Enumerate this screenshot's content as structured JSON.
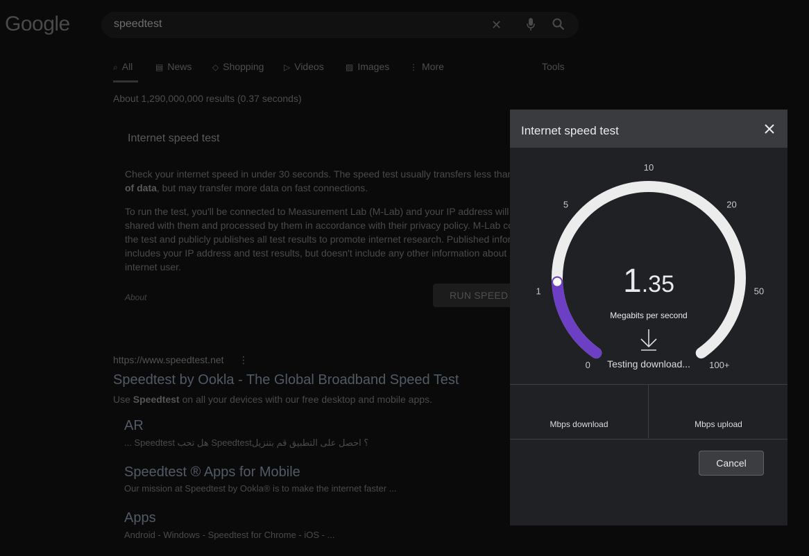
{
  "google": {
    "logo": "Google",
    "search_value": "speedtest",
    "tabs": [
      {
        "label": "All",
        "glyph": "⌕"
      },
      {
        "label": "News",
        "glyph": "▤"
      },
      {
        "label": "Shopping",
        "glyph": "◇"
      },
      {
        "label": "Videos",
        "glyph": "▷"
      },
      {
        "label": "Images",
        "glyph": "▨"
      },
      {
        "label": "More",
        "glyph": "⋮"
      }
    ],
    "tools": "Tools",
    "results_count": "About 1,290,000,000 results (0.37 seconds)",
    "card_title": "Internet speed test",
    "para1_a": "Check your internet speed in under 30 seconds. The speed test usually transfers less than",
    "para1_bold": "of data",
    "para1_b": ", but may transfer more data on fast connections.",
    "para2_lines": [
      "To run the test, you'll be connected to Measurement Lab (M-Lab) and your IP address will",
      "shared with them and processed by them in accordance with their privacy policy. M-Lab co",
      "the test and publicly publishes all test results to promote internet research. Published infor",
      "includes your IP address and test results, but doesn't include any other information about",
      "internet user."
    ],
    "about": "About",
    "run_button": "RUN SPEED",
    "result_url": "https://www.speedtest.net",
    "result_url_menu": "⋮",
    "result_title": "Speedtest by Ookla - The Global Broadband Speed Test",
    "result_desc_pre": "Use ",
    "result_desc_bold": "Speedtest",
    "result_desc_post": " on all your devices with our free desktop and mobile apps.",
    "sublinks": [
      {
        "title": "AR",
        "desc": "... Speedtest هل تحب Speedtest؟ احصل على التطبيق قم بتنزيل"
      },
      {
        "title": "Speedtest ® Apps for Mobile",
        "desc": "Our mission at Speedtest by Ookla® is to make the internet faster ..."
      },
      {
        "title": "Apps",
        "desc": "Android - Windows - Speedtest for Chrome - iOS - ..."
      }
    ]
  },
  "dialog": {
    "title": "Internet speed test",
    "speed_int": "1",
    "speed_dec": ".35",
    "unit": "Megabits per second",
    "status": "Testing download...",
    "download_label": "Mbps download",
    "upload_label": "Mbps upload",
    "cancel_label": "Cancel",
    "gauge": {
      "ticks": [
        "0",
        "1",
        "5",
        "10",
        "20",
        "50",
        "100+"
      ],
      "current_value": 1.35,
      "progress_color": "#6c3fc5",
      "track_color": "#ececec"
    }
  },
  "colors": {
    "accent_purple": "#6c3fc5",
    "dialog_bg": "#202124",
    "header_bg": "#3a3b3e"
  }
}
